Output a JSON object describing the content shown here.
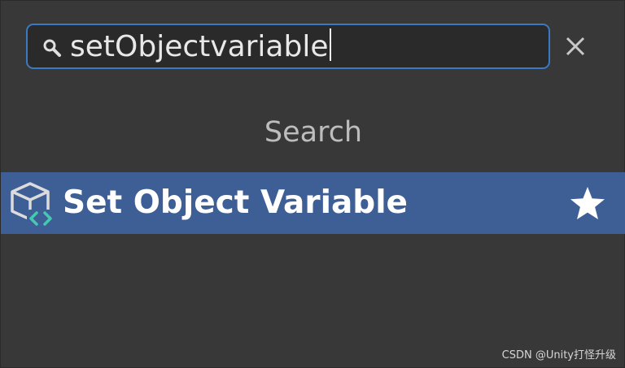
{
  "search": {
    "value": "setObjectvariable",
    "icon": "search-icon",
    "clear_icon": "close-icon"
  },
  "section": {
    "header": "Search"
  },
  "results": [
    {
      "label": "Set Object Variable",
      "icon": "node-variable-icon",
      "favorite_icon": "star-icon",
      "selected": true
    }
  ],
  "watermark": "CSDN @Unity打怪升级",
  "colors": {
    "background": "#383838",
    "field_background": "#2a2a2a",
    "focus_border": "#3b79c2",
    "selection": "#3e5e96",
    "accent_teal": "#46c9b0"
  }
}
